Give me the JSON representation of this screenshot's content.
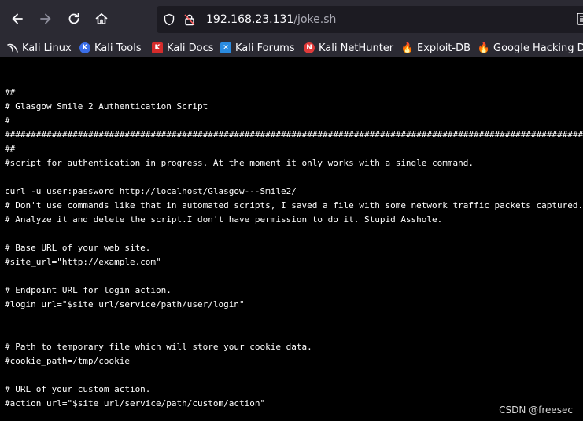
{
  "browser": {
    "url": {
      "host": "192.168.23.131",
      "path": "/joke.sh"
    },
    "bookmarks": [
      {
        "label": "Kali Linux",
        "icon": "kali-dragon-icon",
        "color": "#2b2a33"
      },
      {
        "label": "Kali Tools",
        "icon": "kali-tools-icon",
        "color": "#3a6ee8"
      },
      {
        "label": "Kali Docs",
        "icon": "kali-docs-icon",
        "color": "#d52b2b"
      },
      {
        "label": "Kali Forums",
        "icon": "kali-forums-icon",
        "color": "#2a8be0"
      },
      {
        "label": "Kali NetHunter",
        "icon": "kali-nethunter-icon",
        "color": "#e03a3a"
      },
      {
        "label": "Exploit-DB",
        "icon": "exploit-db-icon",
        "color": "#f06d2b"
      },
      {
        "label": "Google Hacking D",
        "icon": "ghdb-icon",
        "color": "#f06d2b"
      }
    ]
  },
  "file": {
    "lines": [
      "##",
      "# Glasgow Smile 2 Authentication Script",
      "#",
      "##################################################################################################################################",
      "##",
      "#script for authentication in progress. At the moment it only works with a single command.",
      "",
      "curl -u user:password http://localhost/Glasgow---Smile2/",
      "# Don't use commands like that in automated scripts, I saved a file with some network traffic packets captured.",
      "# Analyze it and delete the script.I don't have permission to do it. Stupid Asshole.",
      "",
      "# Base URL of your web site.",
      "#site_url=\"http://example.com\"",
      "",
      "# Endpoint URL for login action.",
      "#login_url=\"$site_url/service/path/user/login\"",
      "",
      "",
      "# Path to temporary file which will store your cookie data.",
      "#cookie_path=/tmp/cookie",
      "",
      "# URL of your custom action.",
      "#action_url=\"$site_url/service/path/custom/action\""
    ]
  },
  "watermark": "CSDN @freesec"
}
